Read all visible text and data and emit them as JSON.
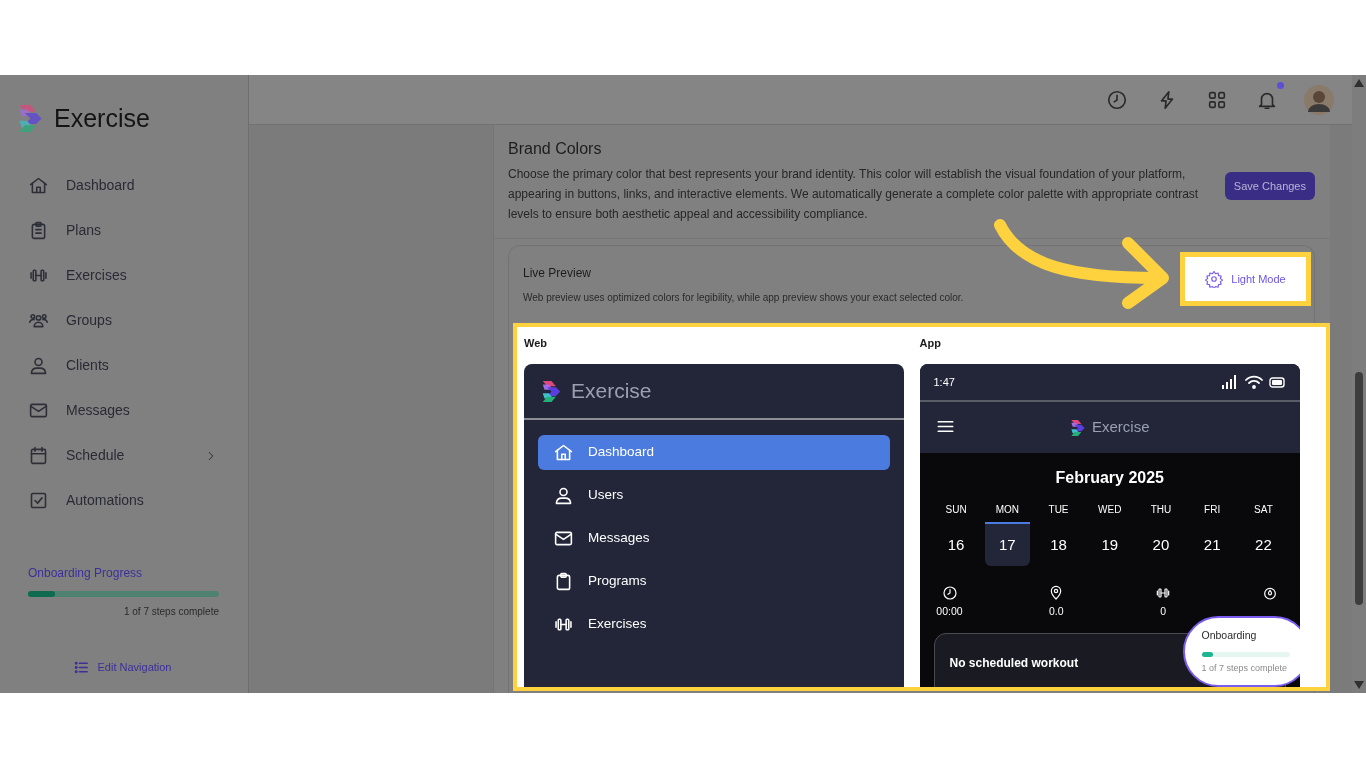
{
  "sidebar": {
    "brand": "Exercise",
    "items": [
      {
        "label": "Dashboard",
        "submenu": false
      },
      {
        "label": "Plans",
        "submenu": false
      },
      {
        "label": "Exercises",
        "submenu": false
      },
      {
        "label": "Groups",
        "submenu": false
      },
      {
        "label": "Clients",
        "submenu": false
      },
      {
        "label": "Messages",
        "submenu": false
      },
      {
        "label": "Schedule",
        "submenu": true
      },
      {
        "label": "Automations",
        "submenu": false
      }
    ],
    "progress": {
      "title": "Onboarding Progress",
      "level": 0.14,
      "caption": "1 of 7 steps complete"
    },
    "edit_link": "Edit Navigation"
  },
  "header": {
    "unread_notifications": true
  },
  "brand_colors": {
    "title": "Brand Colors",
    "description": "Choose the primary color that best represents your brand identity. This color will establish the visual foundation of your platform, appearing in buttons, links, and interactive elements. We automatically generate a complete color palette with appropriate contrast levels to ensure both aesthetic appeal and accessibility compliance.",
    "save_button": "Save Changes"
  },
  "live_preview": {
    "title": "Live Preview",
    "description": "Web preview uses optimized colors for legibility, while app preview shows your exact selected color.",
    "mode_button": "Light Mode",
    "web": {
      "label": "Web",
      "brand": "Exercise",
      "items": [
        {
          "label": "Dashboard",
          "selected": true
        },
        {
          "label": "Users",
          "selected": false
        },
        {
          "label": "Messages",
          "selected": false
        },
        {
          "label": "Programs",
          "selected": false
        },
        {
          "label": "Exercises",
          "selected": false
        }
      ]
    },
    "app": {
      "label": "App",
      "time": "1:47",
      "brand": "Exercise",
      "month": "February 2025",
      "days": [
        {
          "name": "SUN",
          "date": "16",
          "selected": false
        },
        {
          "name": "MON",
          "date": "17",
          "selected": true
        },
        {
          "name": "TUE",
          "date": "18",
          "selected": false
        },
        {
          "name": "WED",
          "date": "19",
          "selected": false
        },
        {
          "name": "THU",
          "date": "20",
          "selected": false
        },
        {
          "name": "FRI",
          "date": "21",
          "selected": false
        },
        {
          "name": "SAT",
          "date": "22",
          "selected": false
        }
      ],
      "stats": [
        "00:00",
        "0.0",
        "0"
      ],
      "card_title": "No scheduled workout",
      "onboarding": {
        "title": "Onboarding",
        "level": 0.13,
        "caption": "1 of 7 steps complete"
      }
    }
  }
}
